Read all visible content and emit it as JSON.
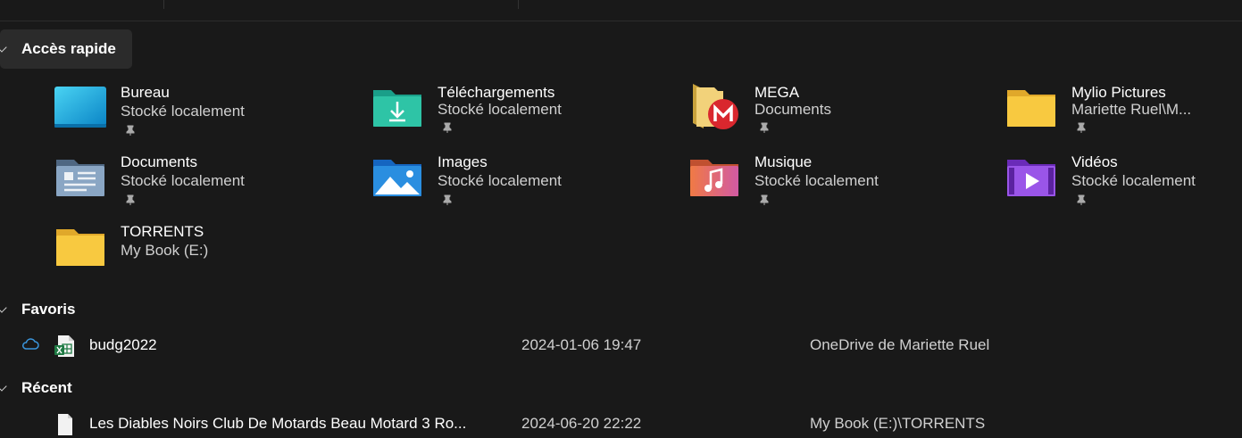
{
  "quick_access": {
    "title": "Accès rapide",
    "items": [
      {
        "name": "Bureau",
        "sub": "Stocké localement",
        "icon": "desktop-folder-icon",
        "pinned": true
      },
      {
        "name": "Téléchargements",
        "sub": "Stocké localement",
        "icon": "downloads-folder-icon",
        "pinned": true
      },
      {
        "name": "MEGA",
        "sub": "Documents",
        "icon": "mega-folder-icon",
        "pinned": true
      },
      {
        "name": "Mylio Pictures",
        "sub": "Mariette Ruel\\M...",
        "icon": "folder-icon",
        "pinned": true
      },
      {
        "name": "Documents",
        "sub": "Stocké localement",
        "icon": "documents-folder-icon",
        "pinned": true
      },
      {
        "name": "Images",
        "sub": "Stocké localement",
        "icon": "pictures-folder-icon",
        "pinned": true
      },
      {
        "name": "Musique",
        "sub": "Stocké localement",
        "icon": "music-folder-icon",
        "pinned": true
      },
      {
        "name": "Vidéos",
        "sub": "Stocké localement",
        "icon": "videos-folder-icon",
        "pinned": true
      },
      {
        "name": "TORRENTS",
        "sub": "My Book (E:)",
        "icon": "folder-icon",
        "pinned": false
      }
    ]
  },
  "favorites": {
    "title": "Favoris",
    "items": [
      {
        "name": "budg2022",
        "date": "2024-01-06 19:47",
        "location": "OneDrive de Mariette Ruel",
        "icon": "excel-file-icon",
        "status_icon": "cloud-icon"
      }
    ]
  },
  "recent": {
    "title": "Récent",
    "items": [
      {
        "name": "Les Diables Noirs Club De Motards Beau Motard 3 Ro...",
        "date": "2024-06-20 22:22",
        "location": "My Book (E:)\\TORRENTS",
        "icon": "file-icon"
      }
    ]
  },
  "colors": {
    "background": "#191919",
    "header_highlight": "#2b2b2b",
    "folder_yellow": "#f8c940",
    "cloud_blue": "#3a96dd"
  }
}
